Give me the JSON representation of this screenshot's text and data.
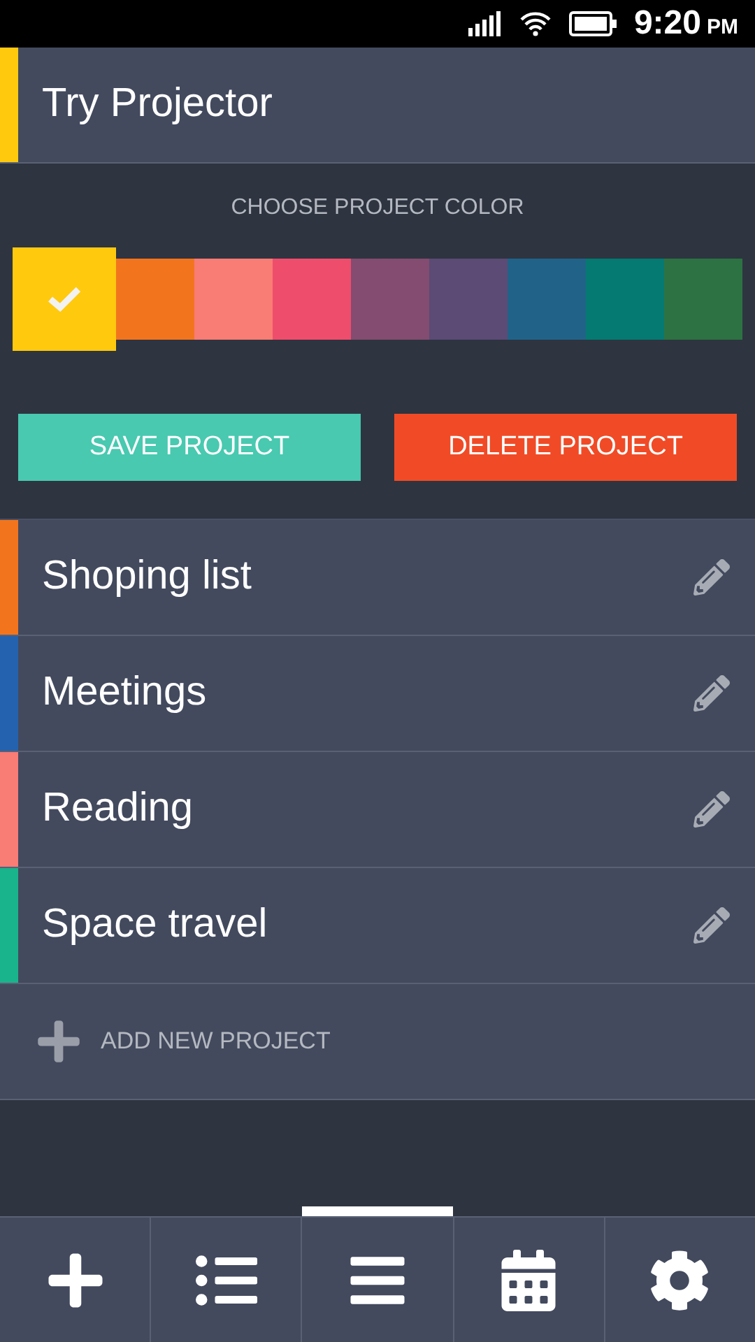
{
  "status_bar": {
    "time": "9:20",
    "period": "PM"
  },
  "editing_project": {
    "name": "Try Projector",
    "color": "#ffc90e"
  },
  "color_picker": {
    "label": "CHOOSE PROJECT COLOR",
    "swatches": [
      {
        "color": "#ffc90e",
        "selected": true
      },
      {
        "color": "#f2751e",
        "selected": false
      },
      {
        "color": "#f97c75",
        "selected": false
      },
      {
        "color": "#ef4d6c",
        "selected": false
      },
      {
        "color": "#834c70",
        "selected": false
      },
      {
        "color": "#5b4b75",
        "selected": false
      },
      {
        "color": "#216388",
        "selected": false
      },
      {
        "color": "#047a72",
        "selected": false
      },
      {
        "color": "#2d7242",
        "selected": false
      }
    ]
  },
  "buttons": [
    {
      "label": "SAVE PROJECT",
      "kind": "save"
    },
    {
      "label": "DELETE PROJECT",
      "kind": "delete"
    }
  ],
  "projects": [
    {
      "name": "Shoping list",
      "color": "#f2751e"
    },
    {
      "name": "Meetings",
      "color": "#2462b0"
    },
    {
      "name": "Reading",
      "color": "#f97c75"
    },
    {
      "name": "Space travel",
      "color": "#19b48c"
    }
  ],
  "add_project": {
    "label": "ADD NEW PROJECT"
  },
  "nav": [
    {
      "kind": "add",
      "selected": false
    },
    {
      "kind": "list",
      "selected": false
    },
    {
      "kind": "menu",
      "selected": true
    },
    {
      "kind": "calendar",
      "selected": false
    },
    {
      "kind": "settings",
      "selected": false
    }
  ]
}
